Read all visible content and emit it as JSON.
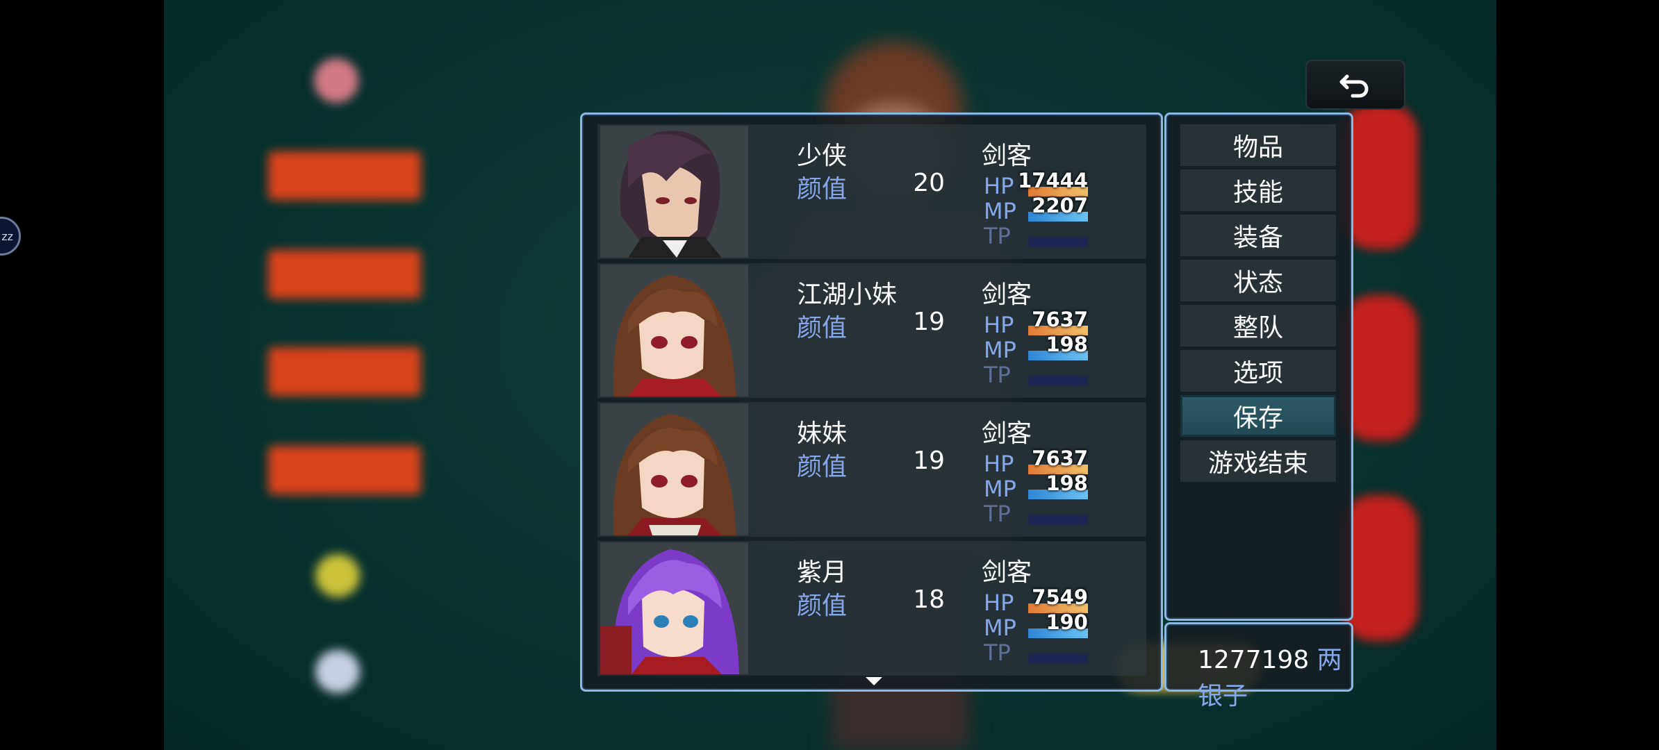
{
  "menu": {
    "commands": [
      "物品",
      "技能",
      "装备",
      "状态",
      "整队",
      "选项",
      "保存",
      "游戏结束"
    ],
    "selected_index": 6
  },
  "party": [
    {
      "name": "少侠",
      "stat_label": "颜值",
      "stat_value": "20",
      "class": "剑客",
      "hp": "17444",
      "mp": "2207",
      "tp_label": "TP",
      "hp_ratio": 1.0,
      "mp_ratio": 1.0,
      "tp_ratio": 0
    },
    {
      "name": "江湖小妹",
      "stat_label": "颜值",
      "stat_value": "19",
      "class": "剑客",
      "hp": "7637",
      "mp": "198",
      "tp_label": "TP",
      "hp_ratio": 1.0,
      "mp_ratio": 1.0,
      "tp_ratio": 0
    },
    {
      "name": "妹妹",
      "stat_label": "颜值",
      "stat_value": "19",
      "class": "剑客",
      "hp": "7637",
      "mp": "198",
      "tp_label": "TP",
      "hp_ratio": 1.0,
      "mp_ratio": 1.0,
      "tp_ratio": 0
    },
    {
      "name": "紫月",
      "stat_label": "颜值",
      "stat_value": "18",
      "class": "剑客",
      "hp": "7549",
      "mp": "190",
      "tp_label": "TP",
      "hp_ratio": 1.0,
      "mp_ratio": 1.0,
      "tp_ratio": 0
    }
  ],
  "labels": {
    "hp": "HP",
    "mp": "MP",
    "tp": "TP"
  },
  "gold": {
    "amount": "1277198",
    "unit": "两银子"
  },
  "colors": {
    "hp_gauge": "#e9a24a",
    "mp_gauge": "#4aa6e6",
    "tp_gauge": "#1c2650",
    "system_text": "#86a8ea",
    "window_border": "#8fb8e0"
  },
  "icons": {
    "back": "back-arrow-icon",
    "scroll": "scroll-down-icon"
  },
  "side_overlay": {
    "text": "zz"
  }
}
